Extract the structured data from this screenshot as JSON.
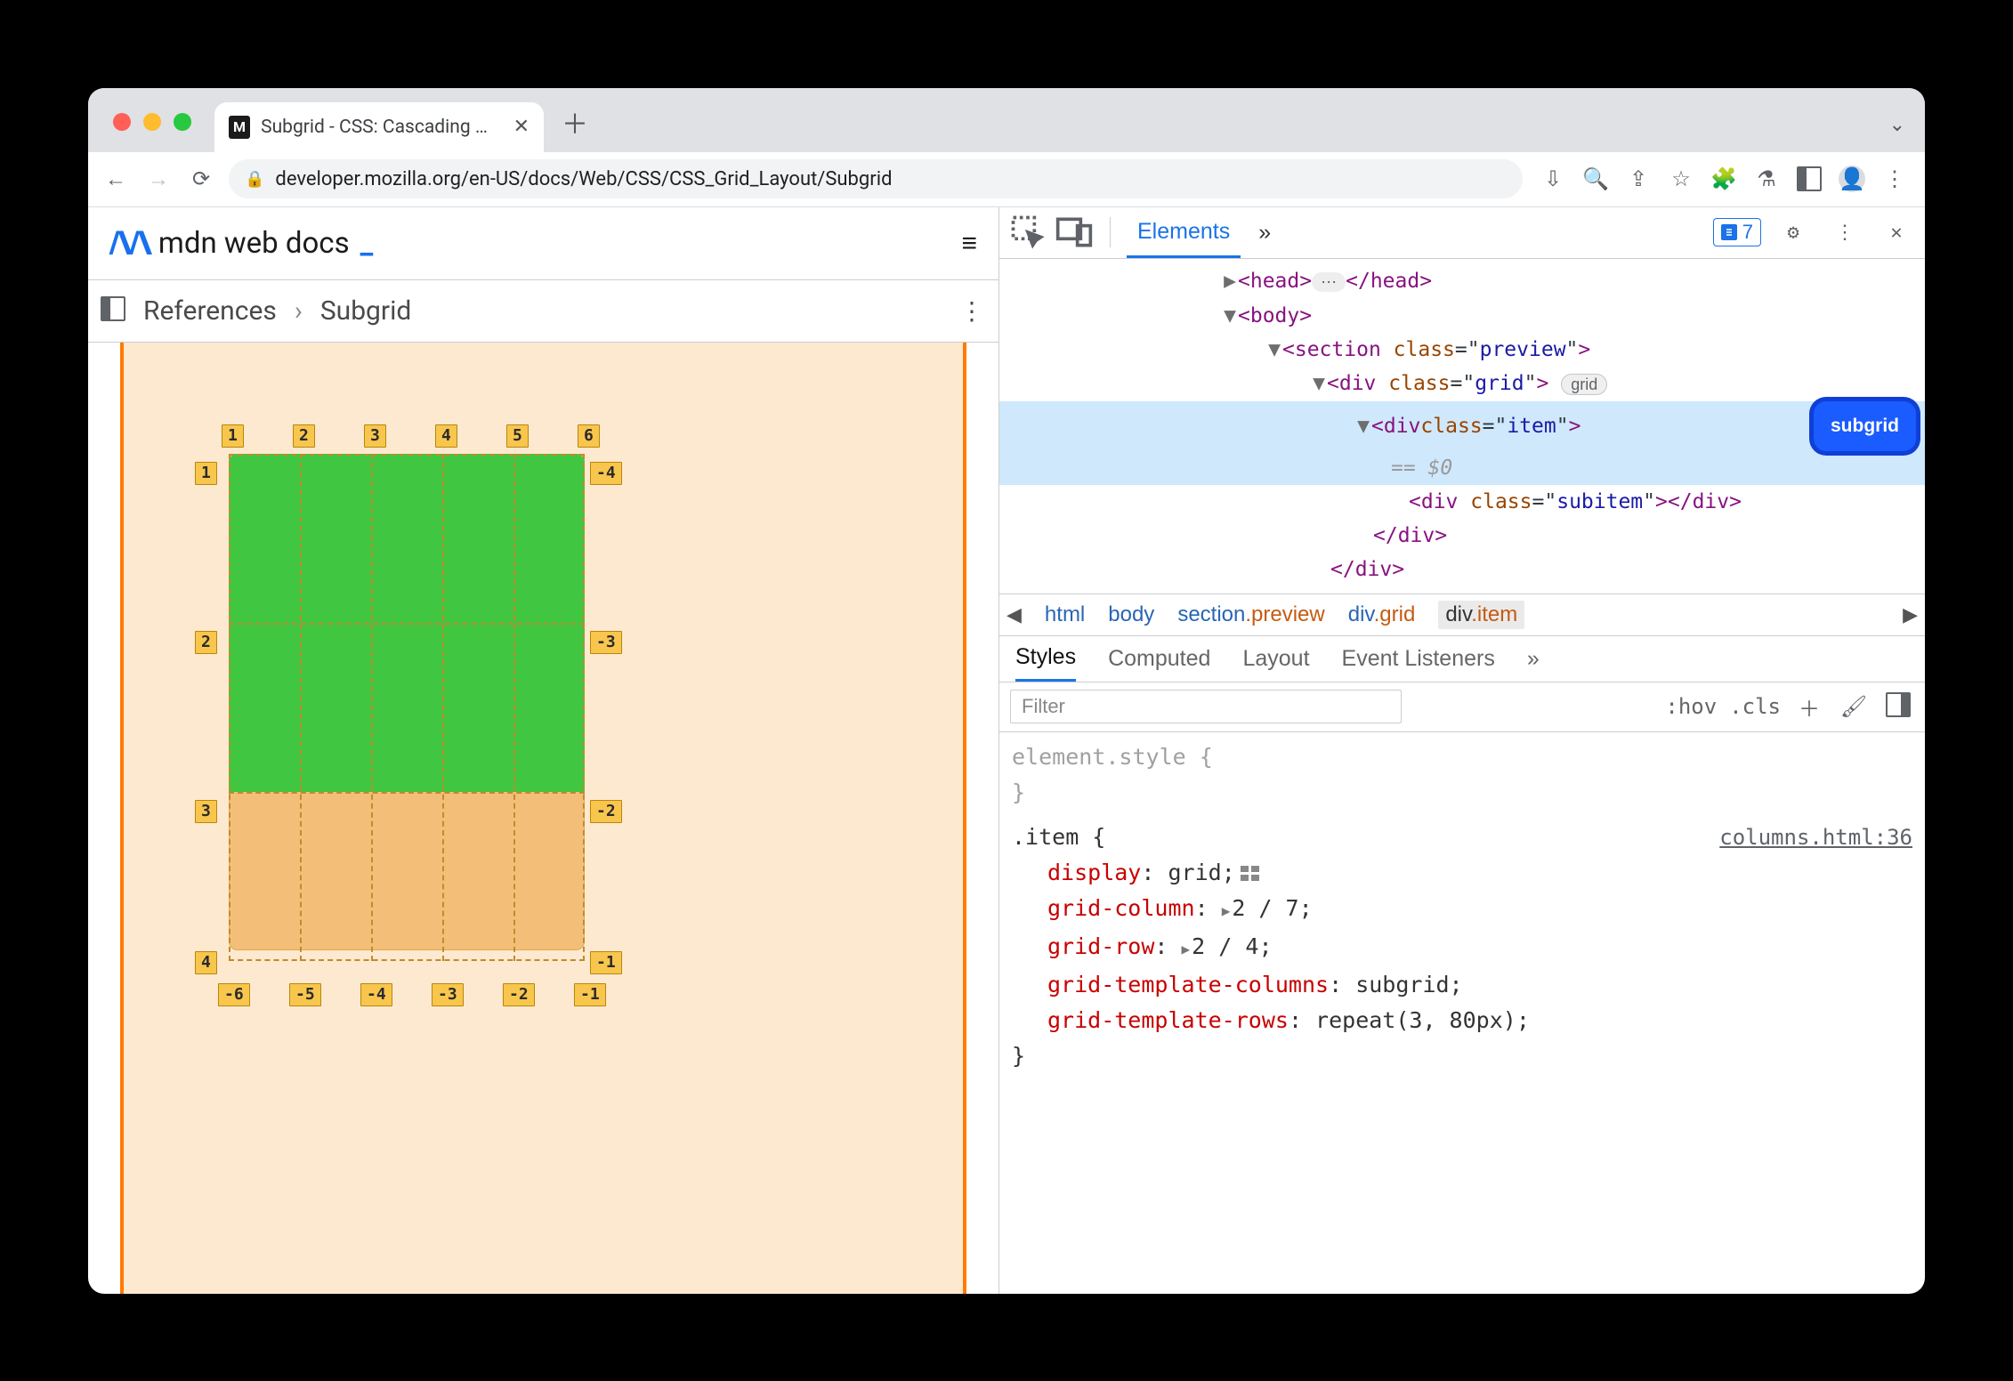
{
  "browser": {
    "tab_title": "Subgrid - CSS: Cascading Style",
    "url": "developer.mozilla.org/en-US/docs/Web/CSS/CSS_Grid_Layout/Subgrid",
    "issues_count": "7"
  },
  "mdn": {
    "brand": "mdn web docs",
    "crumb1": "References",
    "crumb2": "Subgrid",
    "col_labels_top": [
      "1",
      "2",
      "3",
      "4",
      "5",
      "6"
    ],
    "row_labels_left": [
      "1",
      "2",
      "3",
      "4"
    ],
    "row_labels_right": [
      "-4",
      "-3",
      "-2",
      "-1"
    ],
    "col_labels_bottom": [
      "-6",
      "-5",
      "-4",
      "-3",
      "-2",
      "-1"
    ]
  },
  "devtools": {
    "tab_elements": "Elements",
    "dom": {
      "head_open": "<head>",
      "head_close": "</head>",
      "head_ellipsis": "⋯",
      "body_open": "<body>",
      "section_open_name": "section",
      "section_attr": "class",
      "section_val": "preview",
      "div_grid_name": "div",
      "div_grid_val": "grid",
      "grid_badge": "grid",
      "div_item_name": "div",
      "div_item_val": "item",
      "subgrid_badge": "subgrid",
      "eq0": "== $0",
      "div_subitem": "<div class=\"subitem\"></div>",
      "div_close": "</div>",
      "div_close2": "</div>"
    },
    "breadcrumb": {
      "i0": "html",
      "i1": "body",
      "i2a": "section",
      "i2b": ".preview",
      "i3a": "div",
      "i3b": ".grid",
      "i4a": "div",
      "i4b": ".item"
    },
    "styles_tabs": {
      "styles": "Styles",
      "computed": "Computed",
      "layout": "Layout",
      "listeners": "Event Listeners"
    },
    "filter": {
      "placeholder": "Filter",
      "hov": ":hov",
      "cls": ".cls"
    },
    "styles": {
      "element_style": "element.style {",
      "brace_close": "}",
      "item_selector": ".item {",
      "src": "columns.html:36",
      "p_display": "display",
      "v_display": "grid",
      "p_grid_col": "grid-column",
      "v_grid_col": "2 / 7",
      "p_grid_row": "grid-row",
      "v_grid_row": "2 / 4",
      "p_gtc": "grid-template-columns",
      "v_gtc": "subgrid",
      "p_gtr": "grid-template-rows",
      "v_gtr": "repeat(3, 80px)"
    }
  }
}
